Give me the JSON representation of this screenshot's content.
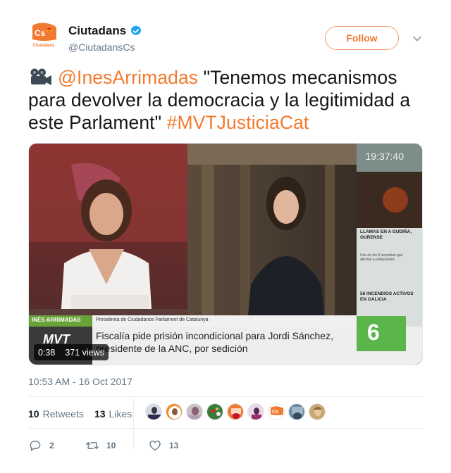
{
  "account": {
    "display_name": "Ciutadans",
    "handle": "@CiutadansCs",
    "logo_text": "Cs",
    "logo_subtext": "Ciudadans",
    "verified": true
  },
  "follow_button": {
    "label": "Follow"
  },
  "tweet": {
    "emoji": "video-camera",
    "mention": "@InesArrimadas",
    "quote_text": " \"Tenemos mecanismos para devolver la democracia y la legitimidad a este Parlament\" ",
    "hashtag": "#MVTJusticiaCat"
  },
  "video": {
    "clock": "19:37:40",
    "duration": "0:38",
    "views": "371 views",
    "lower_third_name": "INÉS ARRIMADAS",
    "lower_third_role": "Presidenta de Ciudadanos Parlament de Catalunya",
    "show_logo": "MVT",
    "headline_line1": "Fiscalía pide prisión incondicional para Jordi Sánchez,",
    "headline_line2": "presidente de la ANC, por sedición",
    "channel": "6",
    "sidebar_headline1": "LLAMAS EN A GUDIÑA, OURENSE",
    "sidebar_body": "Uno de los 8 incendios que afectan a poblaciones",
    "sidebar_headline2": "56 INCENDIOS ACTIVOS EN GALICIA"
  },
  "timestamp": "10:53 AM - 16 Oct 2017",
  "stats": {
    "retweets_count": "10",
    "retweets_label": "Retweets",
    "likes_count": "13",
    "likes_label": "Likes",
    "liker_avatars": 9
  },
  "actions": {
    "replies": "2",
    "retweets": "10",
    "likes": "13"
  },
  "colors": {
    "accent": "#f27a30",
    "verified": "#1da1f2",
    "muted": "#657786"
  }
}
